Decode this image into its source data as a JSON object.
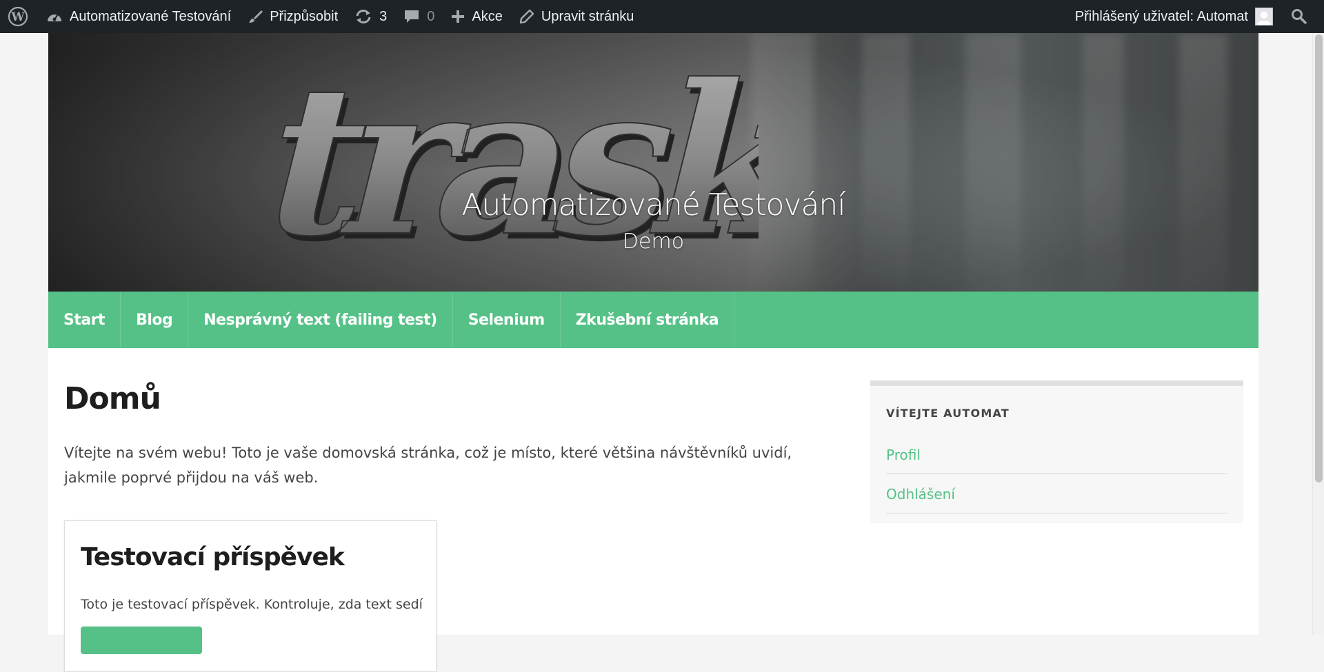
{
  "admin_bar": {
    "site_name": "Automatizované Testování",
    "customize": "Přizpůsobit",
    "updates_count": "3",
    "comments_count": "0",
    "new": "Akce",
    "edit_page": "Upravit stránku",
    "account": "Přihlášený uživatel: Automat"
  },
  "header": {
    "logo_text": "trask",
    "title": "Automatizované Testování",
    "description": "Demo"
  },
  "nav": {
    "items": [
      {
        "label": "Start"
      },
      {
        "label": "Blog"
      },
      {
        "label": "Nesprávný text (failing test)"
      },
      {
        "label": "Selenium"
      },
      {
        "label": "Zkušební stránka"
      }
    ]
  },
  "main": {
    "title": "Domů",
    "intro": "Vítejte na svém webu! Toto je vaše domovská stránka, což je místo, které většina návštěvníků uvidí, jakmile poprvé přijdou na váš web.",
    "post": {
      "title": "Testovací příspěvek",
      "excerpt": "Toto je testovací příspěvek. Kontroluje, zda text sedí"
    }
  },
  "sidebar": {
    "widget_title": "VÍTEJTE AUTOMAT",
    "links": [
      {
        "label": "Profil"
      },
      {
        "label": "Odhlášení"
      }
    ]
  },
  "colors": {
    "admin_bar": "#1d2327",
    "accent": "#55c186",
    "text": "#444444",
    "heading": "#1e1e1e"
  }
}
